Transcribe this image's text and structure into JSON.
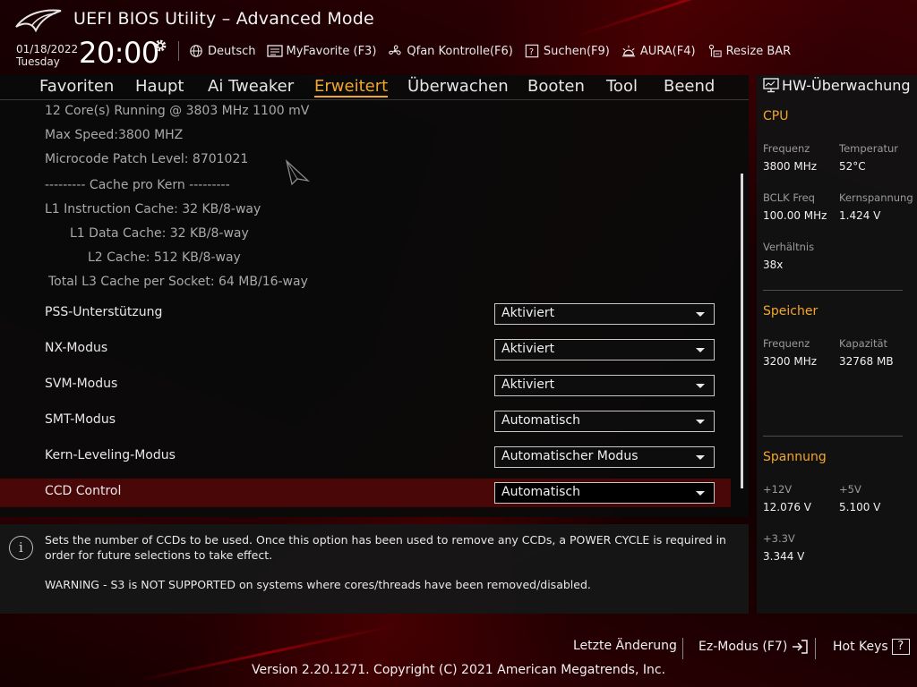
{
  "header": {
    "title": "UEFI BIOS Utility – Advanced Mode",
    "date": "01/18/2022",
    "weekday": "Tuesday",
    "time": "20:00",
    "toolbar": [
      {
        "label": "Deutsch",
        "icon": "globe-icon"
      },
      {
        "label": "MyFavorite (F3)",
        "icon": "favorite-icon"
      },
      {
        "label": "Qfan Kontrolle(F6)",
        "icon": "fan-icon"
      },
      {
        "label": "Suchen(F9)",
        "icon": "help-box-icon"
      },
      {
        "label": "AURA(F4)",
        "icon": "aura-icon"
      },
      {
        "label": "Resize BAR",
        "icon": "resize-bar-icon"
      }
    ]
  },
  "tabs": [
    "Favoriten",
    "Haupt",
    "Ai Tweaker",
    "Erweitert",
    "Überwachen",
    "Booten",
    "Tool",
    "Beend"
  ],
  "active_tab": "Erweitert",
  "info_lines": [
    "12 Core(s) Running @ 3803 MHz  1100 mV",
    "Max Speed:3800 MHZ",
    "Microcode Patch Level: 8701021",
    "--------- Cache pro Kern ---------",
    "L1 Instruction Cache: 32 KB/8-way",
    "L1 Data Cache: 32 KB/8-way",
    "L2 Cache: 512 KB/8-way",
    "Total L3 Cache per Socket: 64 MB/16-way"
  ],
  "settings": [
    {
      "label": "PSS-Unterstützung",
      "value": "Aktiviert"
    },
    {
      "label": "NX-Modus",
      "value": "Aktiviert"
    },
    {
      "label": "SVM-Modus",
      "value": "Aktiviert"
    },
    {
      "label": "SMT-Modus",
      "value": "Automatisch"
    },
    {
      "label": "Kern-Leveling-Modus",
      "value": "Automatischer Modus"
    },
    {
      "label": "CCD Control",
      "value": "Automatisch"
    }
  ],
  "selected_setting": "CCD Control",
  "help": {
    "text": "Sets the number of CCDs to be used. Once this option has been used to remove any CCDs, a POWER CYCLE is required in order for future selections to take effect.",
    "warning": "WARNING - S3 is NOT SUPPORTED on systems where cores/threads have been removed/disabled."
  },
  "hw_monitor": {
    "title": "HW-Überwachung",
    "cpu": {
      "heading": "CPU",
      "freq_label": "Frequenz",
      "freq": "3800 MHz",
      "temp_label": "Temperatur",
      "temp": "52°C",
      "bclk_label": "BCLK Freq",
      "bclk": "100.00 MHz",
      "vcore_label": "Kernspannung",
      "vcore": "1.424 V",
      "ratio_label": "Verhältnis",
      "ratio": "38x"
    },
    "memory": {
      "heading": "Speicher",
      "freq_label": "Frequenz",
      "freq": "3200 MHz",
      "cap_label": "Kapazität",
      "cap": "32768 MB"
    },
    "voltage": {
      "heading": "Spannung",
      "v12_label": "+12V",
      "v12": "12.076 V",
      "v5_label": "+5V",
      "v5": "5.100 V",
      "v33_label": "+3.3V",
      "v33": "3.344 V"
    }
  },
  "footer": {
    "last_change": "Letzte Änderung",
    "ez_mode": "Ez-Modus (F7)",
    "hot_keys": "Hot Keys",
    "hot_keys_key": "?",
    "copyright": "Version 2.20.1271. Copyright (C) 2021 American Megatrends, Inc."
  },
  "colors": {
    "accent": "#f3a72a",
    "selected_row": "#4a0707"
  }
}
